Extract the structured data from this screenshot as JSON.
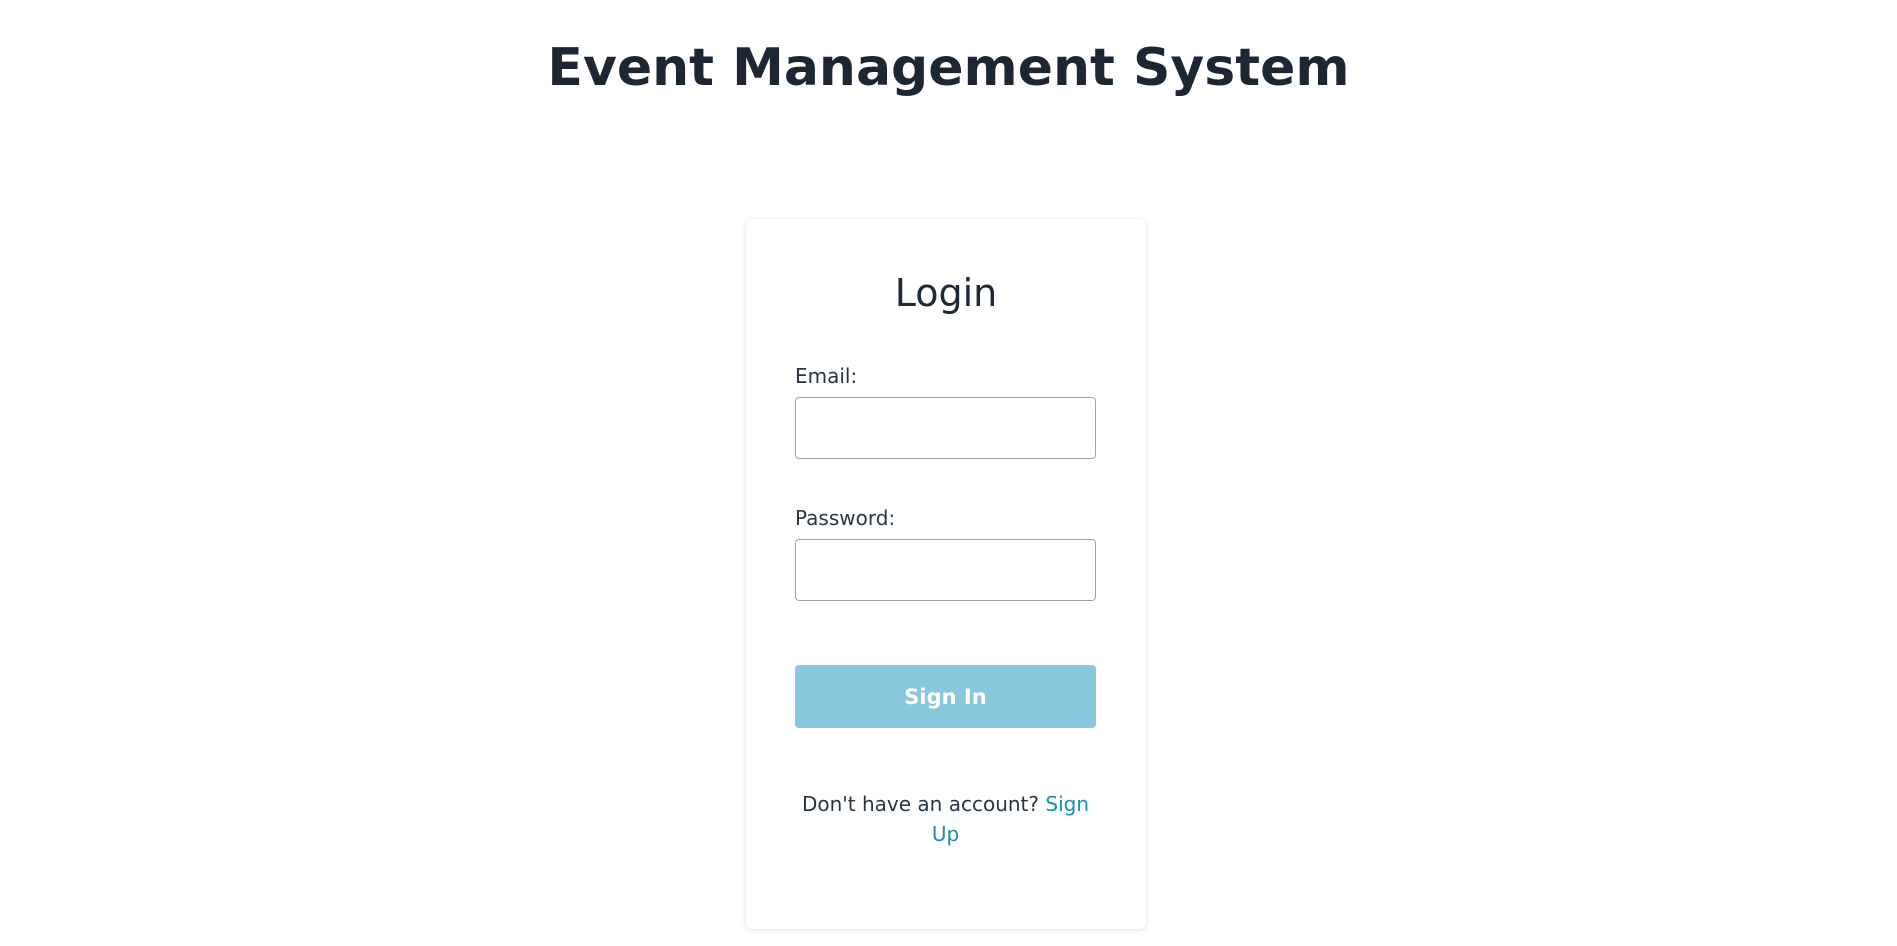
{
  "header": {
    "title": "Event Management System"
  },
  "login_card": {
    "title": "Login",
    "email": {
      "label": "Email:",
      "value": "",
      "placeholder": ""
    },
    "password": {
      "label": "Password:",
      "value": "",
      "placeholder": ""
    },
    "submit_label": "Sign In",
    "signup_prompt": "Don't have an account?",
    "signup_link": "Sign Up"
  },
  "colors": {
    "title_text": "#1d2733",
    "button_background": "#87c8de",
    "button_text": "#ffffff",
    "link": "#1a8db3",
    "input_border": "#9aa3ad"
  }
}
